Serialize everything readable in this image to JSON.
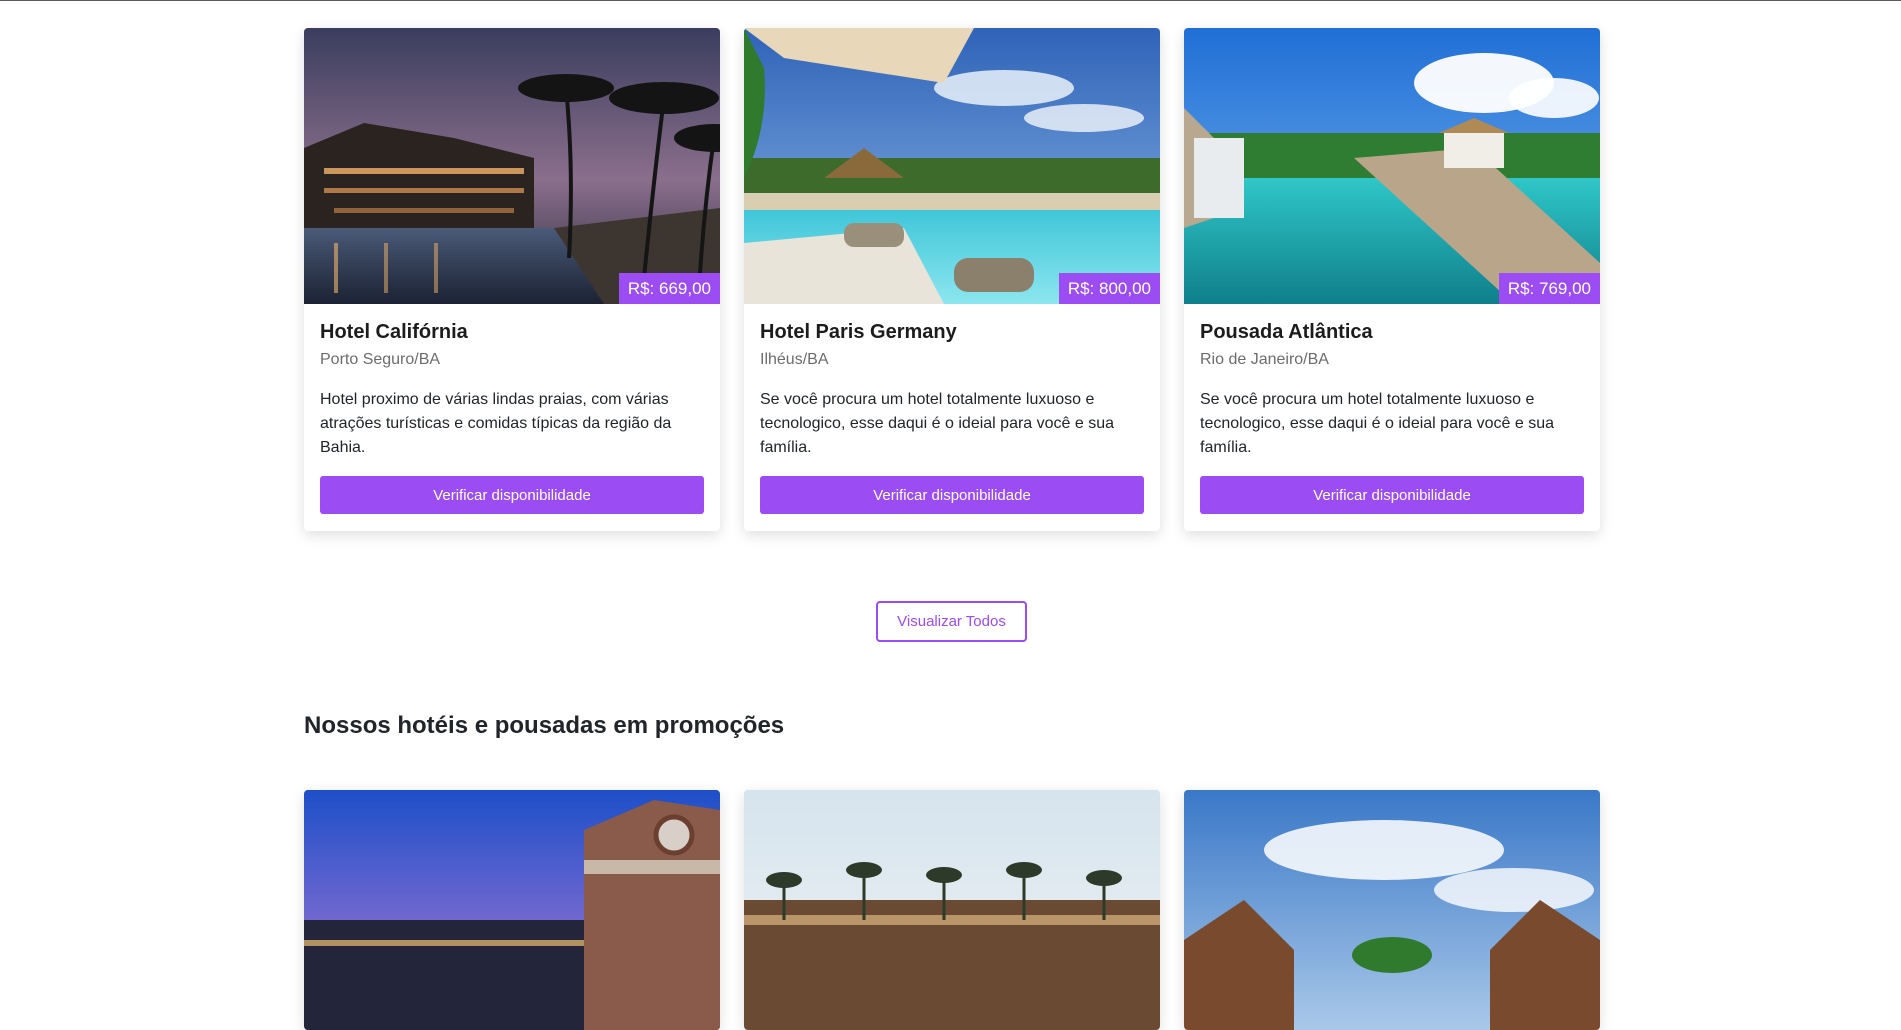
{
  "featured": [
    {
      "title": "Hotel Califórnia",
      "location": "Porto Seguro/BA",
      "price": "R$: 669,00",
      "description": "Hotel proximo de várias lindas praias, com várias atrações turísticas e comidas típicas da região da Bahia.",
      "button": "Verificar disponibilidade"
    },
    {
      "title": "Hotel Paris Germany",
      "location": "Ilhéus/BA",
      "price": "R$: 800,00",
      "description": "Se você procura um hotel totalmente luxuoso e tecnologico, esse daqui é o ideial para você e sua família.",
      "button": "Verificar disponibilidade"
    },
    {
      "title": "Pousada Atlântica",
      "location": "Rio de Janeiro/BA",
      "price": "R$: 769,00",
      "description": "Se você procura um hotel totalmente luxuoso e tecnologico, esse daqui é o ideial para você e sua família.",
      "button": "Verificar disponibilidade"
    }
  ],
  "view_all_label": "Visualizar Todos",
  "promo_section": {
    "title": "Nossos hotéis e pousadas em promoções"
  },
  "colors": {
    "accent": "#9b4cf2",
    "text": "#212529",
    "muted": "#6c6c6c"
  }
}
